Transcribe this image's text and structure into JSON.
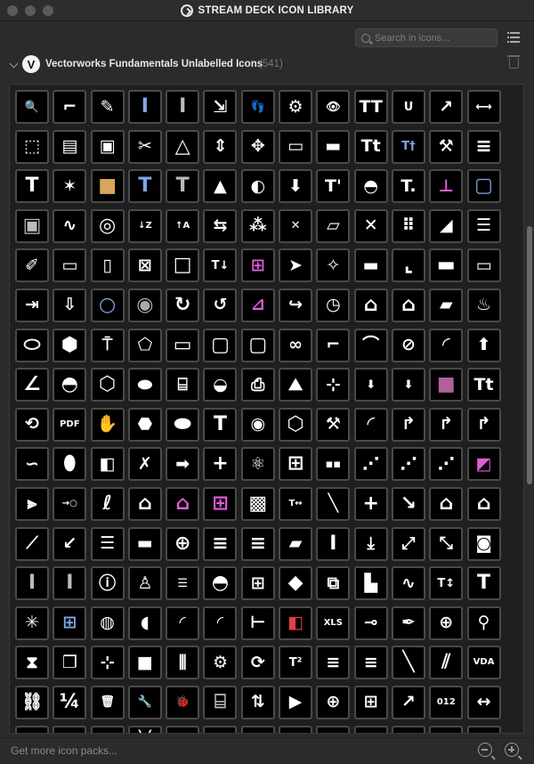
{
  "window": {
    "title": "STREAM DECK ICON LIBRARY"
  },
  "toolbar": {
    "search_placeholder": "Search in icons..."
  },
  "pack": {
    "logo_letter": "V",
    "name": "Vectorworks Fundamentals Unlabelled Icons",
    "count": "(541)"
  },
  "footer": {
    "more_link": "Get more icon packs..."
  },
  "colors": {
    "accent_blue": "#7fa8e6",
    "accent_pink": "#e05bd8",
    "tile_border": "#4a4a4a",
    "tile_bg": "#000000"
  },
  "icons": [
    {
      "name": "zoom-icon",
      "glyph": "🔍",
      "size": "md"
    },
    {
      "name": "stair-icon",
      "glyph": "⌐",
      "size": "lg"
    },
    {
      "name": "pencil-icon",
      "glyph": "✎",
      "size": "lg"
    },
    {
      "name": "i-beam-icon",
      "glyph": "I",
      "size": "xl",
      "color": "#7fa8e6"
    },
    {
      "name": "i-beam-grey-icon",
      "glyph": "I",
      "size": "xl",
      "color": "#bbbbbb"
    },
    {
      "name": "resize-box-icon",
      "glyph": "⇲",
      "size": "lg"
    },
    {
      "name": "footprints-icon",
      "glyph": "👣",
      "size": "md"
    },
    {
      "name": "teapot-gear-icon",
      "glyph": "⚙",
      "size": "lg"
    },
    {
      "name": "eye-gear-icon",
      "glyph": "👁",
      "size": "md"
    },
    {
      "name": "tt-text-icon",
      "glyph": "TT",
      "size": "lg"
    },
    {
      "name": "underline-icon",
      "glyph": "U",
      "size": "md"
    },
    {
      "name": "dimension-angle-icon",
      "glyph": "↗",
      "size": "lg"
    },
    {
      "name": "dimension-tick-icon",
      "glyph": "⟷",
      "size": "md"
    },
    {
      "name": "cube-split-icon",
      "glyph": "⬚",
      "size": "lg"
    },
    {
      "name": "stack-icon",
      "glyph": "▤",
      "size": "lg"
    },
    {
      "name": "node-box-icon",
      "glyph": "▣",
      "size": "lg"
    },
    {
      "name": "scissors-icon",
      "glyph": "✂",
      "size": "lg"
    },
    {
      "name": "triangle-icon",
      "glyph": "△",
      "size": "xl"
    },
    {
      "name": "up-down-icon",
      "glyph": "⇕",
      "size": "lg"
    },
    {
      "name": "move-points-icon",
      "glyph": "✥",
      "size": "lg"
    },
    {
      "name": "frame-icon",
      "glyph": "▭",
      "size": "lg"
    },
    {
      "name": "window-icon",
      "glyph": "▬",
      "size": "lg"
    },
    {
      "name": "tt-small-icon",
      "glyph": "Tt",
      "size": "lg"
    },
    {
      "name": "text-cursor-icon",
      "glyph": "T†",
      "size": "md",
      "color": "#7fa8e6"
    },
    {
      "name": "hammer-icon",
      "glyph": "⚒",
      "size": "lg"
    },
    {
      "name": "align-left-icon",
      "glyph": "≡",
      "size": "xl"
    },
    {
      "name": "text-t-icon",
      "glyph": "T",
      "size": "xl"
    },
    {
      "name": "star-brush-icon",
      "glyph": "✶",
      "size": "lg"
    },
    {
      "name": "box-icon",
      "glyph": "■",
      "size": "xl",
      "color": "#d9a45c"
    },
    {
      "name": "blue-t-icon",
      "glyph": "T",
      "size": "xl",
      "color": "#7fa8e6"
    },
    {
      "name": "grey-t-icon",
      "glyph": "T",
      "size": "xl",
      "color": "#bbbbbb"
    },
    {
      "name": "loft-icon",
      "glyph": "▲",
      "size": "lg"
    },
    {
      "name": "sweep-icon",
      "glyph": "◐",
      "size": "lg"
    },
    {
      "name": "cube-down-icon",
      "glyph": "⬇",
      "size": "lg"
    },
    {
      "name": "text-bold-t-icon",
      "glyph": "T'",
      "size": "lg"
    },
    {
      "name": "half-dome-icon",
      "glyph": "◓",
      "size": "lg"
    },
    {
      "name": "text-t2-icon",
      "glyph": "T.",
      "size": "lg"
    },
    {
      "name": "axis-plane-icon",
      "glyph": "⊥",
      "size": "lg",
      "color": "#e05bd8"
    },
    {
      "name": "rounded-square-blue-icon",
      "glyph": "▢",
      "size": "xl",
      "color": "#7fa8e6"
    },
    {
      "name": "bevel-square-icon",
      "glyph": "▣",
      "size": "xl",
      "color": "#bbbbbb"
    },
    {
      "name": "wave-icon",
      "glyph": "∿",
      "size": "lg"
    },
    {
      "name": "spiral-icon",
      "glyph": "◎",
      "size": "xl"
    },
    {
      "name": "sort-za-icon",
      "glyph": "↓Z",
      "size": "sm"
    },
    {
      "name": "sort-az-icon",
      "glyph": "↑A",
      "size": "sm"
    },
    {
      "name": "mirror-icon",
      "glyph": "⇆",
      "size": "lg"
    },
    {
      "name": "pattern-icon",
      "glyph": "⁂",
      "size": "lg"
    },
    {
      "name": "trim-icon",
      "glyph": "✕",
      "size": "md"
    },
    {
      "name": "slab-icon",
      "glyph": "▱",
      "size": "lg"
    },
    {
      "name": "cross-icon",
      "glyph": "✕",
      "size": "lg"
    },
    {
      "name": "dot-grid-icon",
      "glyph": "⠿",
      "size": "lg"
    },
    {
      "name": "wedge-icon",
      "glyph": "◢",
      "size": "lg"
    },
    {
      "name": "layers-icon",
      "glyph": "☰",
      "size": "lg"
    },
    {
      "name": "eyedropper-icon",
      "glyph": "✐",
      "size": "lg"
    },
    {
      "name": "sheets-icon",
      "glyph": "▭",
      "size": "lg"
    },
    {
      "name": "device-icon",
      "glyph": "▯",
      "size": "lg"
    },
    {
      "name": "frame-x-icon",
      "glyph": "⊠",
      "size": "lg"
    },
    {
      "name": "rectangle-icon",
      "glyph": "□",
      "size": "xl"
    },
    {
      "name": "text-insert-icon",
      "glyph": "T↓",
      "size": "md"
    },
    {
      "name": "pink-grid-icon",
      "glyph": "⊞",
      "size": "lg",
      "color": "#e05bd8"
    },
    {
      "name": "arrow-pointer-icon",
      "glyph": "➤",
      "size": "lg"
    },
    {
      "name": "magic-wand-icon",
      "glyph": "✧",
      "size": "lg"
    },
    {
      "name": "ruler-icon",
      "glyph": "▬",
      "size": "lg"
    },
    {
      "name": "corner-ruler-icon",
      "glyph": "⌞",
      "size": "xl"
    },
    {
      "name": "rounded-rect-icon",
      "glyph": "▬",
      "size": "xl"
    },
    {
      "name": "seat-row-icon",
      "glyph": "▭",
      "size": "lg"
    },
    {
      "name": "table-arrow-icon",
      "glyph": "⇥",
      "size": "lg"
    },
    {
      "name": "window-arrow-icon",
      "glyph": "⇩",
      "size": "lg"
    },
    {
      "name": "circle-blue-icon",
      "glyph": "○",
      "size": "xl",
      "color": "#7fa8e6"
    },
    {
      "name": "ring-icon",
      "glyph": "◉",
      "size": "xl",
      "color": "#aaaaaa"
    },
    {
      "name": "circle-arrow-icon",
      "glyph": "↻",
      "size": "xl"
    },
    {
      "name": "rotate-3d-icon",
      "glyph": "↺",
      "size": "lg"
    },
    {
      "name": "pink-curve-icon",
      "glyph": "⊿",
      "size": "lg",
      "color": "#e05bd8"
    },
    {
      "name": "redo-box-icon",
      "glyph": "↪",
      "size": "lg"
    },
    {
      "name": "timer-icon",
      "glyph": "◷",
      "size": "lg"
    },
    {
      "name": "house-3d-icon",
      "glyph": "⌂",
      "size": "xl"
    },
    {
      "name": "house-icon",
      "glyph": "⌂",
      "size": "xl"
    },
    {
      "name": "photo-icon",
      "glyph": "▰",
      "size": "lg"
    },
    {
      "name": "teapot-icon",
      "glyph": "♨",
      "size": "lg"
    },
    {
      "name": "oval-outline-icon",
      "glyph": "⬭",
      "size": "xl"
    },
    {
      "name": "hexagon-icon",
      "glyph": "⬢",
      "size": "xl"
    },
    {
      "name": "stamp-icon",
      "glyph": "⍑",
      "size": "lg"
    },
    {
      "name": "polygon-icon",
      "glyph": "⬠",
      "size": "lg"
    },
    {
      "name": "rect-outline-icon",
      "glyph": "▭",
      "size": "xl"
    },
    {
      "name": "rounded-outline-icon",
      "glyph": "▢",
      "size": "xl"
    },
    {
      "name": "rounded-box-icon",
      "glyph": "▢",
      "size": "xl"
    },
    {
      "name": "glasses-icon",
      "glyph": "∞",
      "size": "lg"
    },
    {
      "name": "step-line-icon",
      "glyph": "⌐",
      "size": "lg"
    },
    {
      "name": "fillet-icon",
      "glyph": "⌒",
      "size": "lg"
    },
    {
      "name": "circle-line-icon",
      "glyph": "⊘",
      "size": "lg"
    },
    {
      "name": "quarter-circle-icon",
      "glyph": "◜",
      "size": "xl"
    },
    {
      "name": "extrude-icon",
      "glyph": "⬆",
      "size": "lg"
    },
    {
      "name": "angle-icon",
      "glyph": "∠",
      "size": "xl"
    },
    {
      "name": "protractor-icon",
      "glyph": "◓",
      "size": "xl"
    },
    {
      "name": "cube-icon",
      "glyph": "⬡",
      "size": "xl"
    },
    {
      "name": "ellipse-down-icon",
      "glyph": "⬬",
      "size": "lg"
    },
    {
      "name": "cylinder-icon",
      "glyph": "⌸",
      "size": "lg"
    },
    {
      "name": "dome-light-icon",
      "glyph": "◒",
      "size": "lg"
    },
    {
      "name": "printer-icon",
      "glyph": "⎙",
      "size": "lg"
    },
    {
      "name": "terrain-icon",
      "glyph": "⛰",
      "size": "lg"
    },
    {
      "name": "grid-node-icon",
      "glyph": "⊹",
      "size": "lg"
    },
    {
      "name": "box-down-icon",
      "glyph": "⬇",
      "size": "md"
    },
    {
      "name": "box-down2-icon",
      "glyph": "⬇",
      "size": "md"
    },
    {
      "name": "pink-square-icon",
      "glyph": "■",
      "size": "xl",
      "color": "#b0609a"
    },
    {
      "name": "tt-serif-icon",
      "glyph": "Tt",
      "size": "lg"
    },
    {
      "name": "rotate-frame-icon",
      "glyph": "⟲",
      "size": "lg"
    },
    {
      "name": "pdf-icon",
      "glyph": "PDF",
      "size": "sm"
    },
    {
      "name": "hand-icon",
      "glyph": "✋",
      "size": "lg"
    },
    {
      "name": "object-stack-icon",
      "glyph": "⬣",
      "size": "lg"
    },
    {
      "name": "ellipse-icon",
      "glyph": "⬬",
      "size": "xl"
    },
    {
      "name": "t-outline-icon",
      "glyph": "T",
      "size": "xl"
    },
    {
      "name": "eye-box-icon",
      "glyph": "◉",
      "size": "lg"
    },
    {
      "name": "cube-outline-icon",
      "glyph": "⬡",
      "size": "xl"
    },
    {
      "name": "tools-icon",
      "glyph": "⚒",
      "size": "lg"
    },
    {
      "name": "arc-icon",
      "glyph": "◜",
      "size": "xl"
    },
    {
      "name": "arc-arrow-icon",
      "glyph": "↱",
      "size": "lg"
    },
    {
      "name": "arc-arrow2-icon",
      "glyph": "↱",
      "size": "lg"
    },
    {
      "name": "arc-arrow3-icon",
      "glyph": "↱",
      "size": "lg"
    },
    {
      "name": "bezier-icon",
      "glyph": "∽",
      "size": "lg"
    },
    {
      "name": "oval-icon",
      "glyph": "⬮",
      "size": "xl"
    },
    {
      "name": "half-cube-icon",
      "glyph": "◧",
      "size": "lg"
    },
    {
      "name": "x-shape-icon",
      "glyph": "✗",
      "size": "lg"
    },
    {
      "name": "right-arrow-icon",
      "glyph": "➡",
      "size": "lg"
    },
    {
      "name": "plus-icon",
      "glyph": "+",
      "size": "xl"
    },
    {
      "name": "molecule-icon",
      "glyph": "⚛",
      "size": "lg"
    },
    {
      "name": "quad-window-icon",
      "glyph": "⊞",
      "size": "xl"
    },
    {
      "name": "stepper-icon",
      "glyph": "▪▪",
      "size": "md"
    },
    {
      "name": "node-steps-icon",
      "glyph": "⋰",
      "size": "lg"
    },
    {
      "name": "path-step-icon",
      "glyph": "⋰",
      "size": "lg"
    },
    {
      "name": "path-step2-icon",
      "glyph": "⋰",
      "size": "lg"
    },
    {
      "name": "pink-shape-icon",
      "glyph": "◩",
      "size": "lg",
      "color": "#e05bd8"
    },
    {
      "name": "mirror-vertical-icon",
      "glyph": "⫸",
      "size": "lg"
    },
    {
      "name": "arrow-circle-icon",
      "glyph": "→○",
      "size": "sm"
    },
    {
      "name": "lasso-icon",
      "glyph": "ℓ",
      "size": "xl"
    },
    {
      "name": "house-node-icon",
      "glyph": "⌂",
      "size": "xl"
    },
    {
      "name": "house-pink-icon",
      "glyph": "⌂",
      "size": "xl",
      "color": "#e05bd8"
    },
    {
      "name": "pink-window-icon",
      "glyph": "⊞",
      "size": "xl",
      "color": "#e05bd8"
    },
    {
      "name": "qr-code-icon",
      "glyph": "▩",
      "size": "xl"
    },
    {
      "name": "text-align-icon",
      "glyph": "T↔",
      "size": "sm"
    },
    {
      "name": "line-node-icon",
      "glyph": "╲",
      "size": "lg"
    },
    {
      "name": "plus-large-icon",
      "glyph": "+",
      "size": "xl"
    },
    {
      "name": "line-arrow-icon",
      "glyph": "↘",
      "size": "xl"
    },
    {
      "name": "house-box-icon",
      "glyph": "⌂",
      "size": "xl"
    },
    {
      "name": "house-box2-icon",
      "glyph": "⌂",
      "size": "xl"
    },
    {
      "name": "polyline-icon",
      "glyph": "⟋",
      "size": "lg"
    },
    {
      "name": "arrow-back-icon",
      "glyph": "↙",
      "size": "lg"
    },
    {
      "name": "layers-gear-icon",
      "glyph": "☰",
      "size": "lg"
    },
    {
      "name": "scale-bar-icon",
      "glyph": "▬",
      "size": "lg"
    },
    {
      "name": "crosshair-icon",
      "glyph": "⊕",
      "size": "xl"
    },
    {
      "name": "text-lines-icon",
      "glyph": "≡",
      "size": "xl"
    },
    {
      "name": "text-center-icon",
      "glyph": "≡",
      "size": "xl"
    },
    {
      "name": "steel-beam-icon",
      "glyph": "▰",
      "size": "lg"
    },
    {
      "name": "italic-icon",
      "glyph": "I",
      "size": "xl"
    },
    {
      "name": "download-icon",
      "glyph": "⤓",
      "size": "lg"
    },
    {
      "name": "expand-diagonal-icon",
      "glyph": "⤢",
      "size": "lg"
    },
    {
      "name": "expand-arrows-icon",
      "glyph": "⤡",
      "size": "lg"
    },
    {
      "name": "camera-icon",
      "glyph": "◙",
      "size": "lg"
    },
    {
      "name": "column-icon",
      "glyph": "I",
      "size": "xl",
      "color": "#bbbbbb"
    },
    {
      "name": "column-icon2",
      "glyph": "I",
      "size": "xl",
      "color": "#bbbbbb"
    },
    {
      "name": "info-icon",
      "glyph": "ⓘ",
      "size": "lg"
    },
    {
      "name": "person-icon",
      "glyph": "♙",
      "size": "lg"
    },
    {
      "name": "list-indent-icon",
      "glyph": "☰",
      "size": "md"
    },
    {
      "name": "dome-icon",
      "glyph": "◓",
      "size": "xl"
    },
    {
      "name": "grid-frame-icon",
      "glyph": "⊞",
      "size": "lg"
    },
    {
      "name": "diamond-icon",
      "glyph": "◆",
      "size": "xl"
    },
    {
      "name": "layers-box-icon",
      "glyph": "⧉",
      "size": "lg"
    },
    {
      "name": "building-icon",
      "glyph": "▙",
      "size": "lg"
    },
    {
      "name": "sine-wave-icon",
      "glyph": "∿",
      "size": "lg"
    },
    {
      "name": "text-updown-icon",
      "glyph": "T↕",
      "size": "md"
    },
    {
      "name": "big-t-icon",
      "glyph": "T",
      "size": "xl"
    },
    {
      "name": "burst-icon",
      "glyph": "✳",
      "size": "lg"
    },
    {
      "name": "blue-grid-icon",
      "glyph": "⊞",
      "size": "lg",
      "color": "#7fa8e6"
    },
    {
      "name": "planet-icon",
      "glyph": "◍",
      "size": "lg"
    },
    {
      "name": "door-icon",
      "glyph": "◖",
      "size": "lg"
    },
    {
      "name": "curve-icon",
      "glyph": "◜",
      "size": "lg"
    },
    {
      "name": "curve2-icon",
      "glyph": "◜",
      "size": "lg"
    },
    {
      "name": "key-node-icon",
      "glyph": "⊢",
      "size": "lg"
    },
    {
      "name": "red-cube-icon",
      "glyph": "◧",
      "size": "lg",
      "color": "#e04040"
    },
    {
      "name": "xls-icon",
      "glyph": "XLS",
      "size": "sm"
    },
    {
      "name": "key-line-icon",
      "glyph": "⊸",
      "size": "lg"
    },
    {
      "name": "pen-icon",
      "glyph": "✒",
      "size": "lg"
    },
    {
      "name": "doc-plus-icon",
      "glyph": "⊕",
      "size": "lg"
    },
    {
      "name": "tag-gear-icon",
      "glyph": "⚲",
      "size": "lg"
    },
    {
      "name": "triangles-icon",
      "glyph": "⧗",
      "size": "lg"
    },
    {
      "name": "copy-icon",
      "glyph": "❐",
      "size": "lg"
    },
    {
      "name": "cursor-split-icon",
      "glyph": "⊹",
      "size": "lg"
    },
    {
      "name": "shadow-square-icon",
      "glyph": "■",
      "size": "lg"
    },
    {
      "name": "columns-icon",
      "glyph": "⫼",
      "size": "lg"
    },
    {
      "name": "gear-pen-icon",
      "glyph": "⚙",
      "size": "lg"
    },
    {
      "name": "cycle-icon",
      "glyph": "⟳",
      "size": "lg"
    },
    {
      "name": "t-squared-icon",
      "glyph": "T²",
      "size": "md"
    },
    {
      "name": "lines-arrow-icon",
      "glyph": "≡",
      "size": "lg"
    },
    {
      "name": "lines-arrow2-icon",
      "glyph": "≡",
      "size": "lg"
    },
    {
      "name": "diagonal-line-icon",
      "glyph": "╲",
      "size": "xl"
    },
    {
      "name": "double-line-icon",
      "glyph": "⫽",
      "size": "xl"
    },
    {
      "name": "vda-import-icon",
      "glyph": "VDA",
      "size": "sm"
    },
    {
      "name": "link-icon",
      "glyph": "⛓",
      "size": "lg"
    },
    {
      "name": "fraction-icon",
      "glyph": "¼",
      "size": "xl"
    },
    {
      "name": "trash-icon",
      "glyph": "🗑",
      "size": "md"
    },
    {
      "name": "wrench-icon",
      "glyph": "🔧",
      "size": "md"
    },
    {
      "name": "bug-icon",
      "glyph": "🐞",
      "size": "md"
    },
    {
      "name": "cylinder-grey-icon",
      "glyph": "⌸",
      "size": "xl",
      "color": "#bbbbbb"
    },
    {
      "name": "sort-order-icon",
      "glyph": "⇅",
      "size": "lg"
    },
    {
      "name": "play-doc-icon",
      "glyph": "▶",
      "size": "lg"
    },
    {
      "name": "center-move-icon",
      "glyph": "⊕",
      "size": "lg"
    },
    {
      "name": "plus-box-icon",
      "glyph": "⊞",
      "size": "lg"
    },
    {
      "name": "trend-icon",
      "glyph": "↗",
      "size": "lg"
    },
    {
      "name": "counter-icon",
      "glyph": "012",
      "size": "sm"
    },
    {
      "name": "dimension-icon",
      "glyph": "↔",
      "size": "lg"
    },
    {
      "name": "width-icon",
      "glyph": "⟷",
      "size": "lg"
    },
    {
      "name": "arrowhead-icon",
      "glyph": "▲",
      "size": "lg"
    },
    {
      "name": "mountain-icon",
      "glyph": "▲",
      "size": "xl"
    },
    {
      "name": "x-lines-icon",
      "glyph": "╳",
      "size": "xl"
    },
    {
      "name": "cone-icon",
      "glyph": "▲",
      "size": "xl",
      "color": "#dddddd"
    },
    {
      "name": "t-block-icon",
      "glyph": "T",
      "size": "xl"
    },
    {
      "name": "gear-icon",
      "glyph": "⚙",
      "size": "xl"
    },
    {
      "name": "color-wheel-icon",
      "glyph": "✺",
      "size": "xl",
      "color": "#e05bd8"
    },
    {
      "name": "dashed-circle-icon",
      "glyph": "◌",
      "size": "xl"
    },
    {
      "name": "switch-icon",
      "glyph": "▯",
      "size": "lg"
    },
    {
      "name": "share-nodes-icon",
      "glyph": "⋔",
      "size": "lg"
    },
    {
      "name": "circle-icon",
      "glyph": "○",
      "size": "xl"
    },
    {
      "name": "blue-bracket-icon",
      "glyph": "⊏",
      "size": "xl",
      "color": "#7fa8e6"
    },
    {
      "name": "angle-line-icon",
      "glyph": "⟋",
      "size": "xl"
    },
    {
      "name": "chamfer-icon",
      "glyph": "⟋",
      "size": "xl"
    },
    {
      "name": "target-icon",
      "glyph": "⊕",
      "size": "xl"
    }
  ]
}
